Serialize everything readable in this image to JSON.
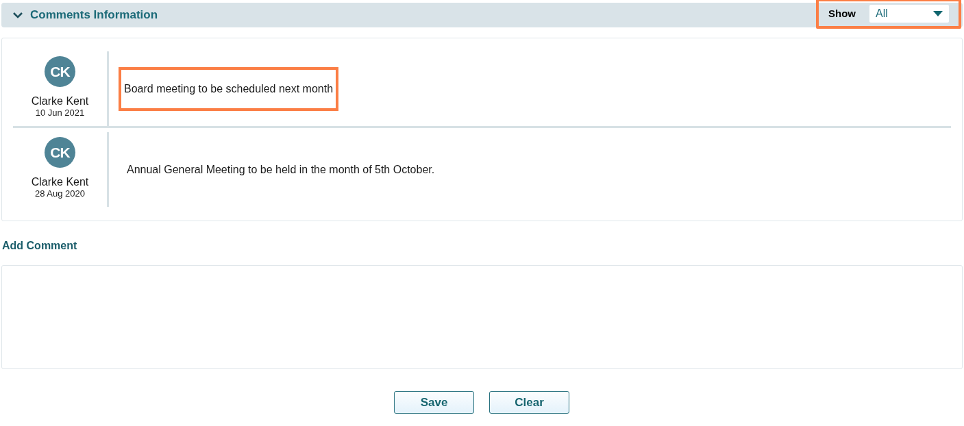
{
  "section": {
    "title": "Comments Information",
    "expanded": true,
    "filter": {
      "label": "Show",
      "value": "All",
      "highlighted": true
    }
  },
  "comments": [
    {
      "initials": "CK",
      "author": "Clarke Kent",
      "date": "10 Jun 2021",
      "text": "Board meeting to be scheduled next month",
      "highlighted": true
    },
    {
      "initials": "CK",
      "author": "Clarke Kent",
      "date": "28 Aug 2020",
      "text": "Annual General Meeting to be held in the month of 5th October.",
      "highlighted": false
    }
  ],
  "add_comment": {
    "label": "Add Comment"
  },
  "buttons": [
    "Save",
    "Clear"
  ]
}
